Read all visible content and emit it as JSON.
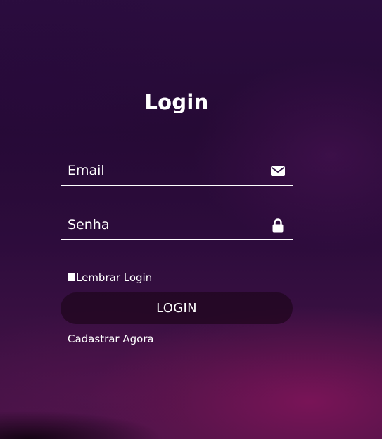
{
  "login": {
    "title": "Login",
    "email_field": {
      "value": "Email",
      "icon": "envelope-icon"
    },
    "password_field": {
      "value": "Senha",
      "icon": "lock-icon"
    },
    "remember": {
      "label": "Lembrar Login",
      "checked": false
    },
    "submit_label": "LOGIN",
    "register_link": "Cadastrar Agora"
  },
  "colors": {
    "text": "#ffffff",
    "background_top": "#2b0d3f",
    "background_bottom": "#4a1448",
    "button_bg": "#1e061c"
  }
}
